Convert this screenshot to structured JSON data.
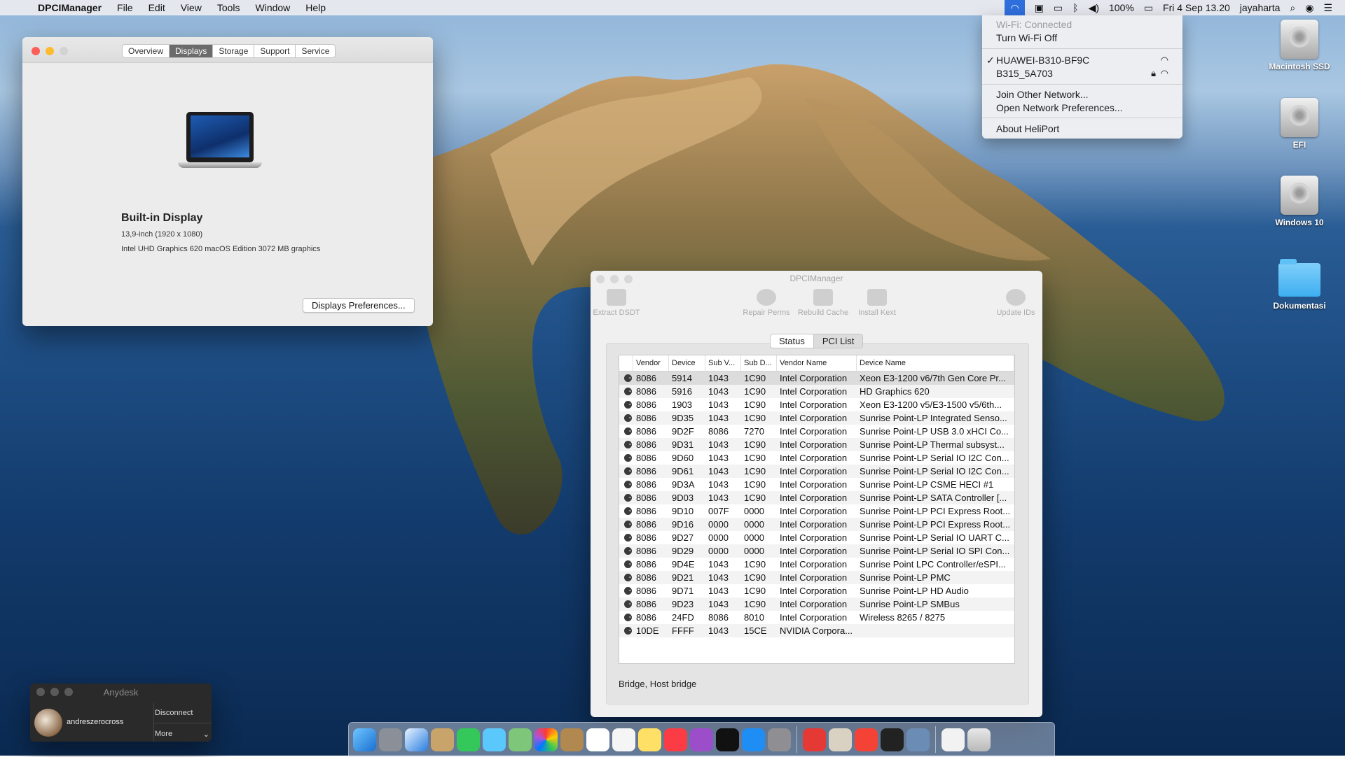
{
  "menubar": {
    "app_name": "DPCIManager",
    "menus": [
      "File",
      "Edit",
      "View",
      "Tools",
      "Window",
      "Help"
    ],
    "battery": "100%",
    "datetime": "Fri 4 Sep  13.20",
    "user": "jayaharta"
  },
  "wifi_menu": {
    "status": "Wi-Fi: Connected",
    "toggle": "Turn Wi-Fi Off",
    "networks": [
      "HUAWEI-B310-BF9C",
      "B315_5A703"
    ],
    "join": "Join Other Network...",
    "open_prefs": "Open Network Preferences...",
    "about": "About HeliPort"
  },
  "desktop_icons": [
    "Macintosh SSD",
    "EFI",
    "Windows 10",
    "Dokumentasi"
  ],
  "about_window": {
    "tabs": [
      "Overview",
      "Displays",
      "Storage",
      "Support",
      "Service"
    ],
    "active_tab": "Displays",
    "display_name": "Built-in Display",
    "resolution": "13,9-inch (1920 x 1080)",
    "graphics": "Intel UHD Graphics 620 macOS Edition 3072 MB graphics",
    "button": "Displays Preferences..."
  },
  "dpci_window": {
    "title": "DPCIManager",
    "toolbar": {
      "extract": "Extract DSDT",
      "repair": "Repair Perms",
      "rebuild": "Rebuild Cache",
      "install": "Install Kext",
      "update": "Update IDs"
    },
    "tabs": [
      "Status",
      "PCI List"
    ],
    "columns": [
      "Vendor",
      "Device",
      "Sub V...",
      "Sub D...",
      "Vendor Name",
      "Device Name"
    ],
    "rows": [
      [
        "8086",
        "5914",
        "1043",
        "1C90",
        "Intel Corporation",
        "Xeon E3-1200 v6/7th Gen Core Pr..."
      ],
      [
        "8086",
        "5916",
        "1043",
        "1C90",
        "Intel Corporation",
        "HD Graphics 620"
      ],
      [
        "8086",
        "1903",
        "1043",
        "1C90",
        "Intel Corporation",
        "Xeon E3-1200 v5/E3-1500 v5/6th..."
      ],
      [
        "8086",
        "9D35",
        "1043",
        "1C90",
        "Intel Corporation",
        "Sunrise Point-LP Integrated Senso..."
      ],
      [
        "8086",
        "9D2F",
        "8086",
        "7270",
        "Intel Corporation",
        "Sunrise Point-LP USB 3.0 xHCI Co..."
      ],
      [
        "8086",
        "9D31",
        "1043",
        "1C90",
        "Intel Corporation",
        "Sunrise Point-LP Thermal subsyst..."
      ],
      [
        "8086",
        "9D60",
        "1043",
        "1C90",
        "Intel Corporation",
        "Sunrise Point-LP Serial IO I2C Con..."
      ],
      [
        "8086",
        "9D61",
        "1043",
        "1C90",
        "Intel Corporation",
        "Sunrise Point-LP Serial IO I2C Con..."
      ],
      [
        "8086",
        "9D3A",
        "1043",
        "1C90",
        "Intel Corporation",
        "Sunrise Point-LP CSME HECI #1"
      ],
      [
        "8086",
        "9D03",
        "1043",
        "1C90",
        "Intel Corporation",
        "Sunrise Point-LP SATA Controller [..."
      ],
      [
        "8086",
        "9D10",
        "007F",
        "0000",
        "Intel Corporation",
        "Sunrise Point-LP PCI Express Root..."
      ],
      [
        "8086",
        "9D16",
        "0000",
        "0000",
        "Intel Corporation",
        "Sunrise Point-LP PCI Express Root..."
      ],
      [
        "8086",
        "9D27",
        "0000",
        "0000",
        "Intel Corporation",
        "Sunrise Point-LP Serial IO UART C..."
      ],
      [
        "8086",
        "9D29",
        "0000",
        "0000",
        "Intel Corporation",
        "Sunrise Point-LP Serial IO SPI Con..."
      ],
      [
        "8086",
        "9D4E",
        "1043",
        "1C90",
        "Intel Corporation",
        "Sunrise Point LPC Controller/eSPI..."
      ],
      [
        "8086",
        "9D21",
        "1043",
        "1C90",
        "Intel Corporation",
        "Sunrise Point-LP PMC"
      ],
      [
        "8086",
        "9D71",
        "1043",
        "1C90",
        "Intel Corporation",
        "Sunrise Point-LP HD Audio"
      ],
      [
        "8086",
        "9D23",
        "1043",
        "1C90",
        "Intel Corporation",
        "Sunrise Point-LP SMBus"
      ],
      [
        "8086",
        "24FD",
        "8086",
        "8010",
        "Intel Corporation",
        "Wireless 8265 / 8275"
      ],
      [
        "10DE",
        "FFFF",
        "1043",
        "15CE",
        "NVIDIA Corpora...",
        ""
      ]
    ],
    "status_text": "Bridge, Host bridge"
  },
  "anydesk": {
    "title": "Anydesk",
    "user": "andreszerocross",
    "disconnect": "Disconnect",
    "more": "More"
  }
}
